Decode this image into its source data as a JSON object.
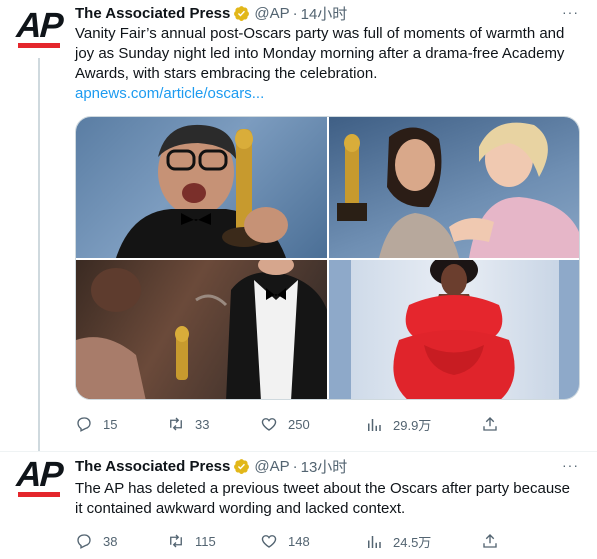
{
  "tweets": [
    {
      "author": "The Associated Press",
      "handle": "@AP",
      "dot": "·",
      "time": "14小时",
      "text": "Vanity Fair’s annual post-Oscars party was full of moments of warmth and joy as Sunday night led into Monday morning after a drama-free Academy Awards, with stars embracing the celebration.",
      "link": "apnews.com/article/oscars...",
      "replies": "15",
      "retweets": "33",
      "likes": "250",
      "views": "29.9万"
    },
    {
      "author": "The Associated Press",
      "handle": "@AP",
      "dot": "·",
      "time": "13小时",
      "text": "The AP has deleted a previous tweet about the Oscars after party because it contained awkward wording and lacked context.",
      "replies": "38",
      "retweets": "115",
      "likes": "148",
      "views": "24.5万"
    }
  ],
  "logo_text": "AP",
  "more_label": "···",
  "colors": {
    "accent": "#1d9bf0",
    "ap_red": "#e4262c",
    "verified_gold": "#e2b719",
    "muted": "#536471"
  }
}
